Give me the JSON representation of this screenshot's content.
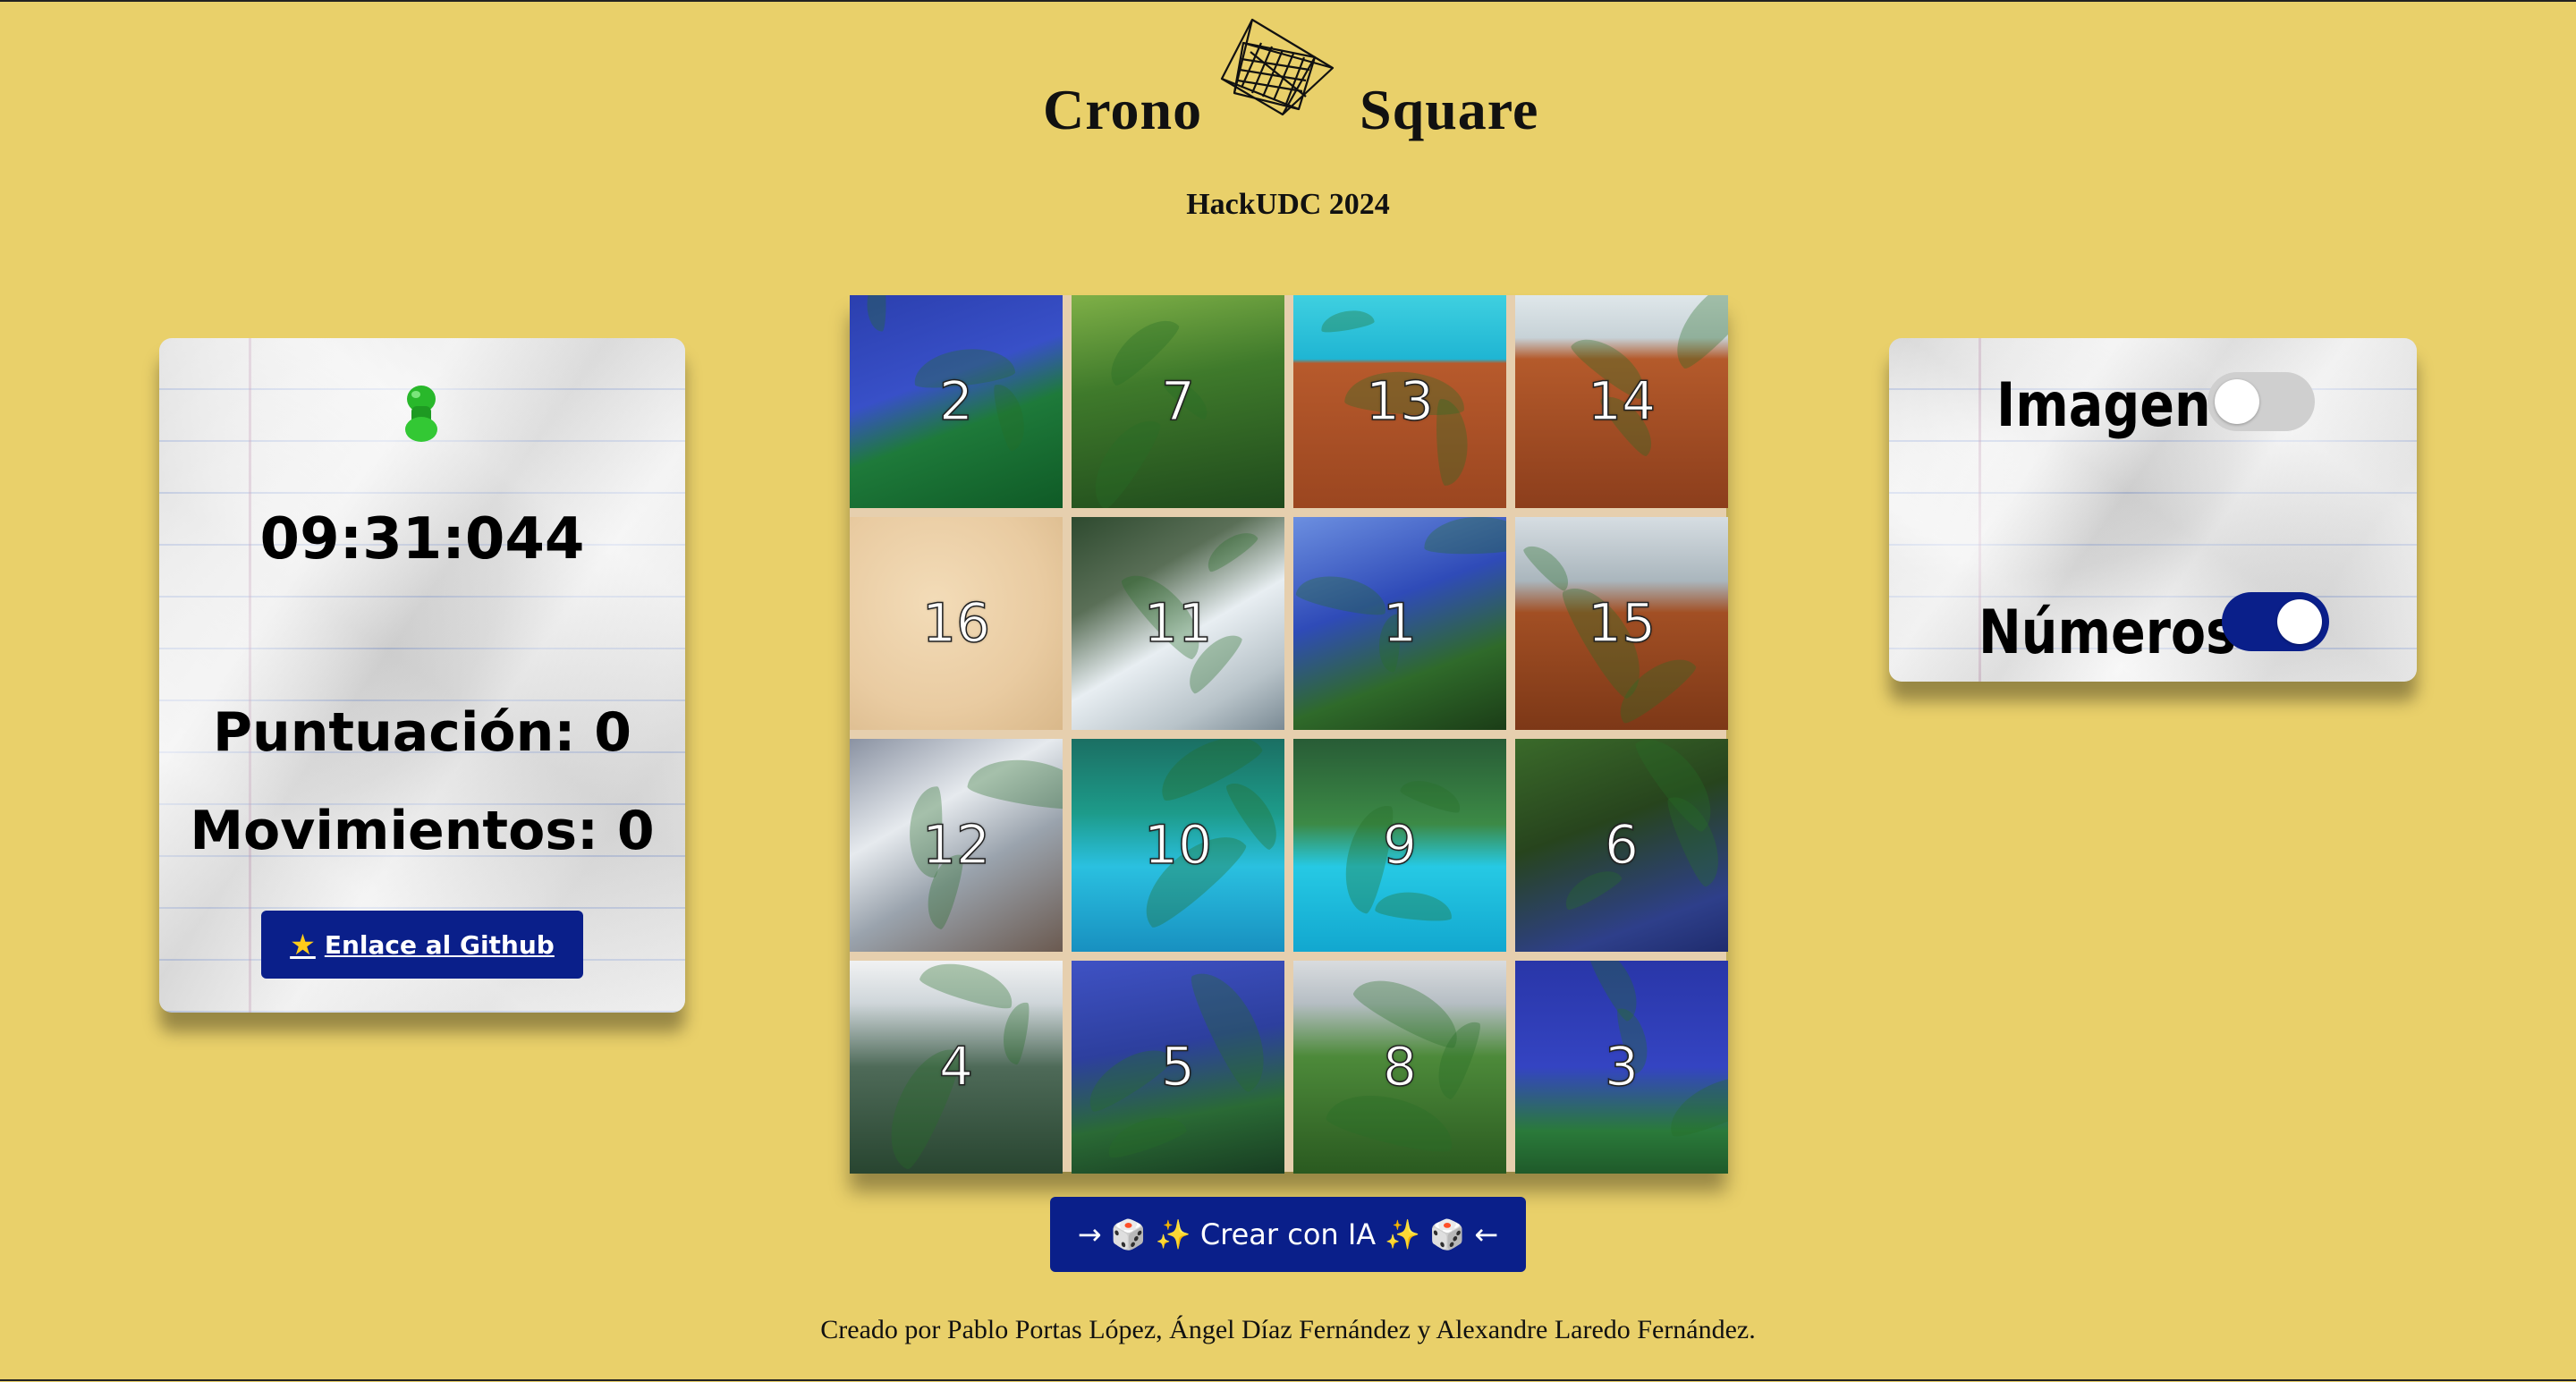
{
  "header": {
    "title_left": "Crono",
    "title_right": "Square",
    "subtitle": "HackUDC 2024",
    "logo_icon": "geometric-wireframe-logo"
  },
  "stats_card": {
    "pin_icon": "green-pushpin-icon",
    "timer": "09:31:044",
    "score": "Puntuación: 0",
    "moves": "Movimientos: 0",
    "github_icon": "star-icon",
    "github_label": "Enlace al Github"
  },
  "settings_card": {
    "image_label": "Imagen",
    "image_on": false,
    "numbers_label": "Números",
    "numbers_on": true
  },
  "puzzle": {
    "tiles": [
      {
        "number": "2",
        "scene": "t-sky"
      },
      {
        "number": "7",
        "scene": "t-jungle"
      },
      {
        "number": "13",
        "scene": "t-pool-deck"
      },
      {
        "number": "14",
        "scene": "t-deck-suit"
      },
      {
        "number": "16",
        "scene": "t-sand"
      },
      {
        "number": "11",
        "scene": "t-suit"
      },
      {
        "number": "1",
        "scene": "t-palm-sky"
      },
      {
        "number": "15",
        "scene": "t-ship"
      },
      {
        "number": "12",
        "scene": "t-astro"
      },
      {
        "number": "10",
        "scene": "t-pool"
      },
      {
        "number": "9",
        "scene": "t-pool2"
      },
      {
        "number": "6",
        "scene": "t-palm-dark"
      },
      {
        "number": "4",
        "scene": "t-building"
      },
      {
        "number": "5",
        "scene": "t-palm-hill"
      },
      {
        "number": "8",
        "scene": "t-roof-trees"
      },
      {
        "number": "3",
        "scene": "t-blue-palm"
      }
    ]
  },
  "ai_button": {
    "label": "→ 🎲 ✨ Crear con IA ✨ 🎲 ←"
  },
  "footer": {
    "credits": "Creado por Pablo Portas López, Ángel Díaz Fernández y Alexandre Laredo Fernández."
  }
}
